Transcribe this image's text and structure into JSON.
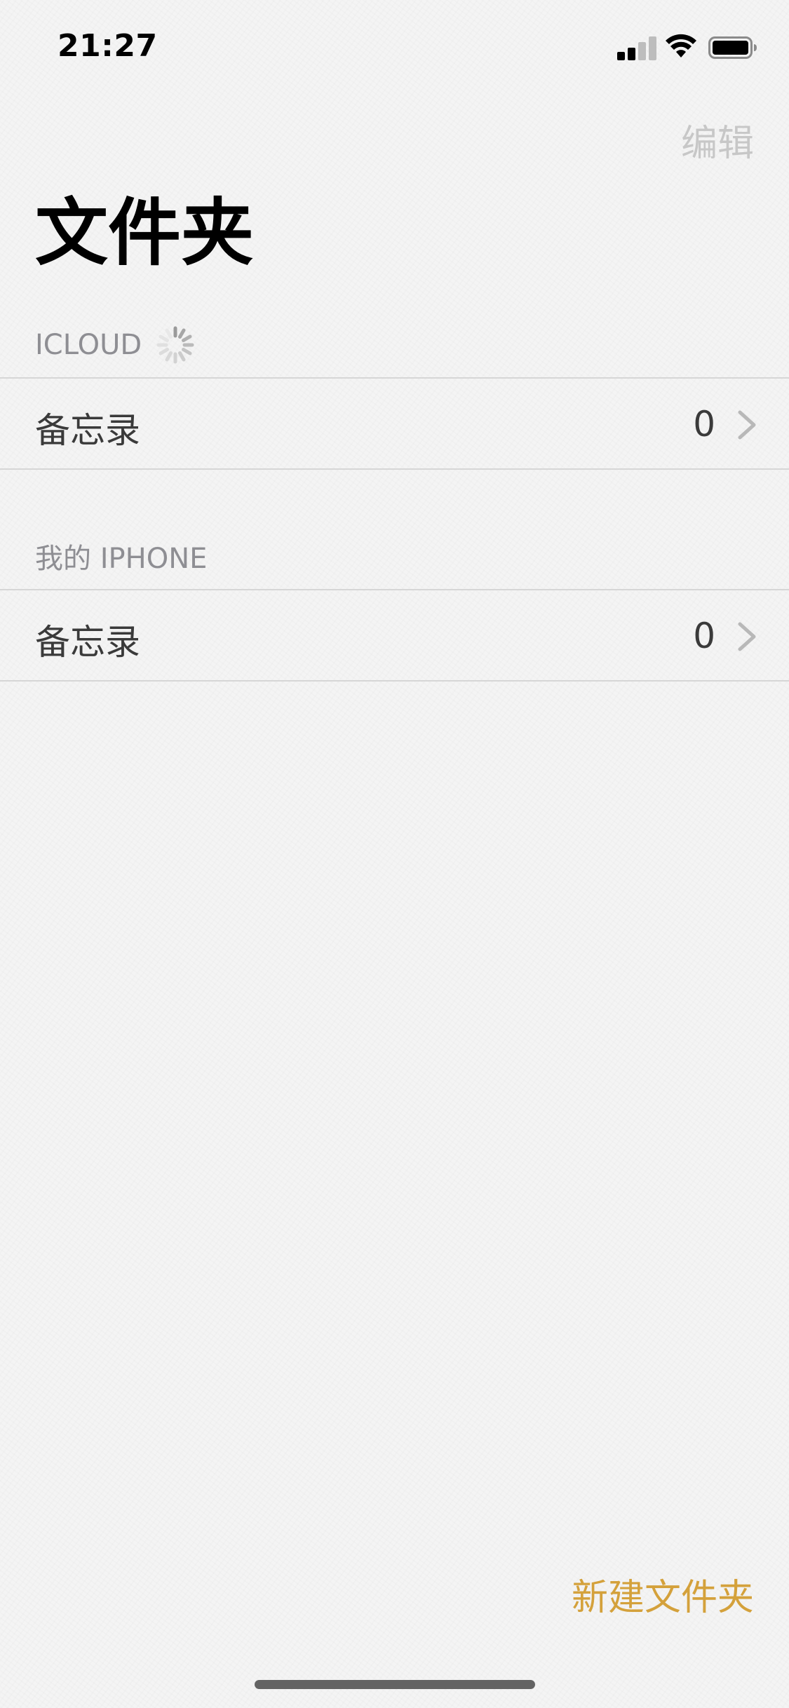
{
  "status_bar": {
    "time": "21:27",
    "signal_icon": "cellular-signal-icon",
    "wifi_icon": "wifi-icon",
    "battery_icon": "battery-icon"
  },
  "nav": {
    "edit_label": "编辑",
    "title": "文件夹"
  },
  "sections": {
    "icloud": {
      "header": "ICLOUD",
      "loading_icon": "loading-spinner-icon",
      "folder": {
        "label": "备忘录",
        "count": "0"
      }
    },
    "iphone": {
      "header": "我的 IPHONE",
      "folder": {
        "label": "备忘录",
        "count": "0"
      }
    }
  },
  "toolbar": {
    "new_folder_label": "新建文件夹"
  },
  "colors": {
    "accent": "#d4a13b",
    "disabled": "#c7c7c7",
    "secondary_text": "#8e8e93",
    "background": "#f4f4f4"
  }
}
